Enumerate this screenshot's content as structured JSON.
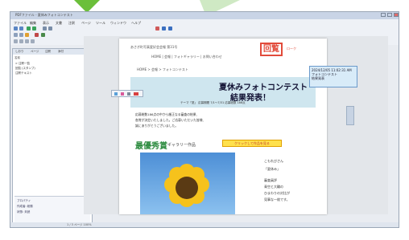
{
  "window": {
    "title": "PDFファイル - 夏休みフォトコンテスト"
  },
  "menu": [
    "ファイル",
    "編集",
    "表示",
    "文書",
    "注釈",
    "ページ",
    "ツール",
    "ウィンドウ",
    "ヘルプ"
  ],
  "left_panel": {
    "tabs": [
      "しおり",
      "ページ",
      "注釈",
      "添付"
    ],
    "header": "名前",
    "rows": [
      "> 注釈一覧",
      "  回覧 (スタンプ)",
      "  注釈テキスト"
    ],
    "bottom_lines": [
      "プロパティ",
      "作成者: 総務",
      "状態: 未読"
    ]
  },
  "page": {
    "header_small": "あさぎ町写真愛好会会報 第31号",
    "nav_links": "HOME  |  会報  |  フォトギャラリー  |  お問い合わせ",
    "breadcrumb": "HOME > 会報 > フォトコンテスト",
    "stamp": "回覧",
    "stamp_label": "ローク",
    "banner_title_1": "夏休みフォトコンテスト",
    "banner_title_2": "結果発表！",
    "banner_sub": "テーマ「夏」 応募期間 7/1〜7/31 応募総数 186点",
    "paras": [
      "応募総数186点の中から厳正なる審査の結果、",
      "各賞が決定いたしました。ご応募いただいた皆様、",
      "誠にありがとうございました。"
    ],
    "prize": "最優秀賞",
    "prize_sub": "ギャラリー作品",
    "yellow_box": "クリックして作品を見る",
    "right_texts": [
      "こもれびさん",
      "「夏休み」",
      "審査員評",
      "青空と大輪の",
      "ひまわりの対比が",
      "見事な一枚です。"
    ]
  },
  "note": {
    "date": "2024/12/05 11:02:31 AM",
    "line2": "フォトコンテスト",
    "line3": "結果発表"
  },
  "status": "1 / 3  ページ    100%"
}
